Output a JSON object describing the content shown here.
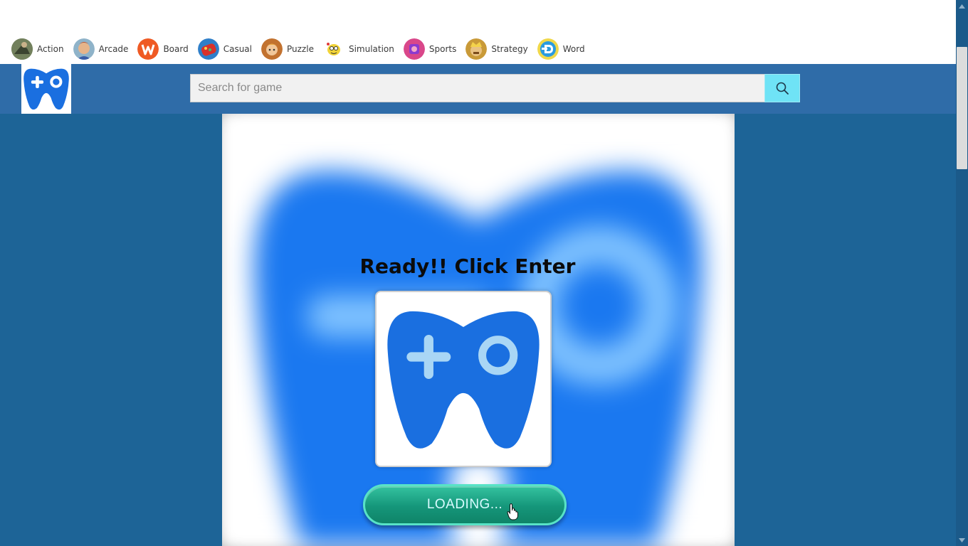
{
  "categories": [
    {
      "label": "Action",
      "icon": "action-game-icon",
      "color": "#5b6b4a"
    },
    {
      "label": "Arcade",
      "icon": "arcade-game-icon",
      "color": "#b96b3a"
    },
    {
      "label": "Board",
      "icon": "board-game-icon",
      "color": "#e8622a"
    },
    {
      "label": "Casual",
      "icon": "casual-game-icon",
      "color": "#c9302c"
    },
    {
      "label": "Puzzle",
      "icon": "puzzle-game-icon",
      "color": "#d9943a"
    },
    {
      "label": "Simulation",
      "icon": "simulation-game-icon",
      "color": "#f0d23a"
    },
    {
      "label": "Sports",
      "icon": "sports-game-icon",
      "color": "#d84a8a"
    },
    {
      "label": "Strategy",
      "icon": "strategy-game-icon",
      "color": "#caa040"
    },
    {
      "label": "Word",
      "icon": "word-game-icon",
      "color": "#2f9be0"
    }
  ],
  "search": {
    "placeholder": "Search for game",
    "value": ""
  },
  "game": {
    "title": "Ready!! Click Enter",
    "button_label": "LOADING..."
  },
  "colors": {
    "header_blue": "#2f6ca8",
    "page_blue": "#1d6497",
    "logo_blue": "#1a6fe0",
    "search_button": "#6fe3f6",
    "loading_button": "#15967a"
  }
}
